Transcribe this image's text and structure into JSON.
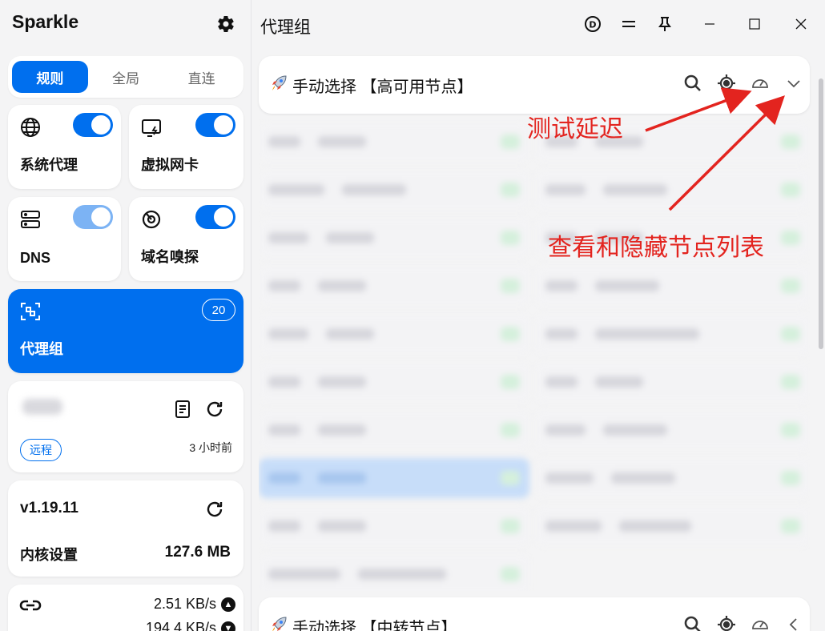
{
  "app": {
    "title": "Sparkle"
  },
  "mode_tabs": [
    {
      "label": "规则",
      "active": true
    },
    {
      "label": "全局",
      "active": false
    },
    {
      "label": "直连",
      "active": false
    }
  ],
  "tiles": {
    "system_proxy": {
      "label": "系统代理",
      "enabled": true
    },
    "tun": {
      "label": "虚拟网卡",
      "enabled": true
    },
    "dns": {
      "label": "DNS",
      "enabled": true
    },
    "sniff": {
      "label": "域名嗅探",
      "enabled": true
    }
  },
  "proxy_groups_nav": {
    "label": "代理组",
    "count": "20"
  },
  "subscription": {
    "tag": "远程",
    "updated": "3 小时前"
  },
  "core": {
    "version": "v1.19.11",
    "label": "内核设置",
    "memory": "127.6 MB"
  },
  "traffic": {
    "upload": "2.51 KB/s",
    "download": "194.4 KB/s"
  },
  "main": {
    "title": "代理组"
  },
  "groups": [
    {
      "name": "手动选择 【高可用节点】",
      "expanded": true
    },
    {
      "name": "手动选择 【中转节点】",
      "expanded": false
    }
  ],
  "annotations": {
    "test_latency": "测试延迟",
    "toggle_list": "查看和隐藏节点列表"
  },
  "colors": {
    "accent": "#006fee",
    "annotation": "#e3241f",
    "latency_ok": "#17c964"
  },
  "icons": [
    "gear-icon",
    "globe-icon",
    "tun-icon",
    "server-icon",
    "sniff-icon",
    "proxy-group-icon",
    "document-icon",
    "refresh-icon",
    "link-icon",
    "search-icon",
    "locate-icon",
    "gauge-icon",
    "chevron-down-icon",
    "chevron-left-icon",
    "pin-icon",
    "minimize-icon",
    "maximize-icon",
    "close-icon",
    "rocket-icon"
  ]
}
